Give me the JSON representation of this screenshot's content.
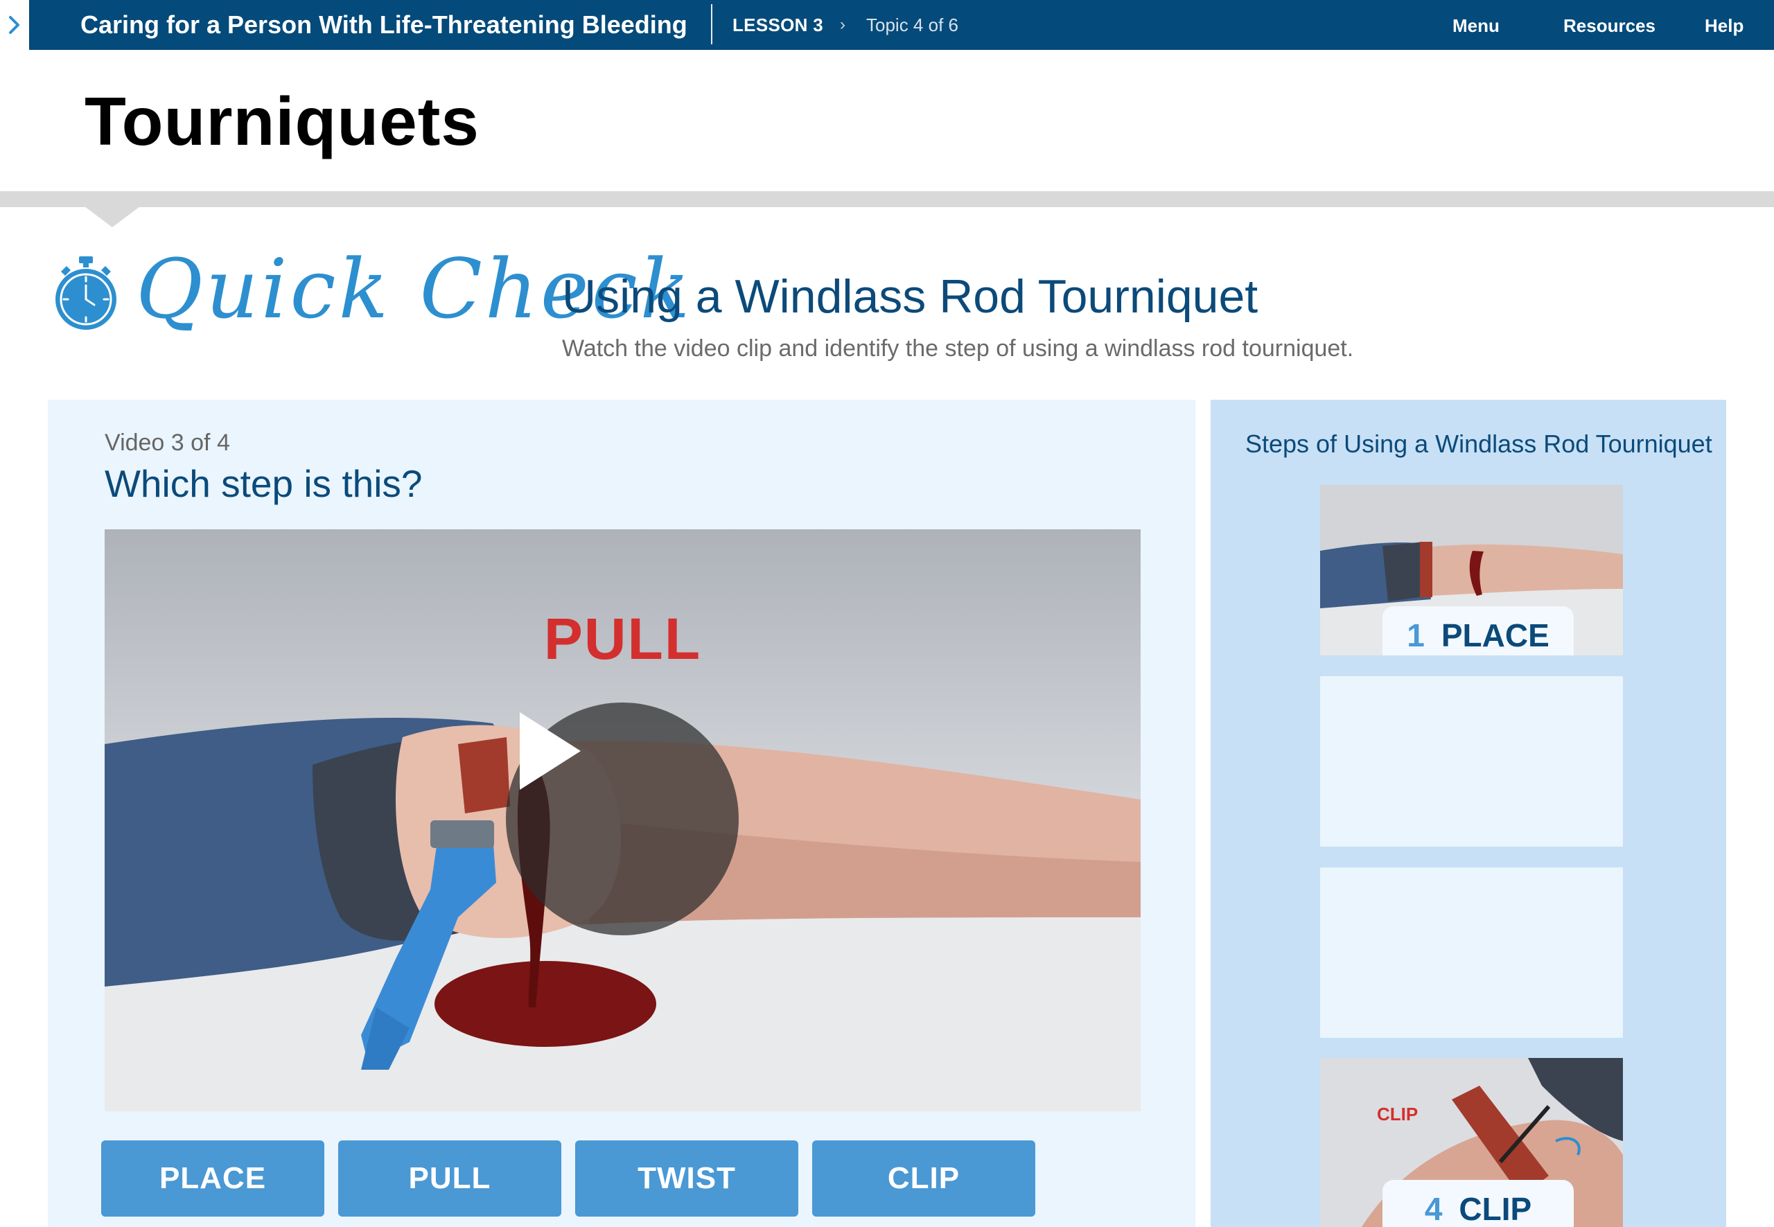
{
  "topbar": {
    "course_title": "Caring for a Person With Life-Threatening Bleeding",
    "lesson": "LESSON 3",
    "topic": "Topic 4 of 6",
    "nav": {
      "menu": "Menu",
      "resources": "Resources",
      "help": "Help"
    }
  },
  "page": {
    "title": "Tourniquets"
  },
  "activity": {
    "badge": "Quick Check",
    "title": "Using a Windlass Rod Tourniquet",
    "instructions": "Watch the video clip and identify the step of using a windlass rod tourniquet."
  },
  "video": {
    "counter": "Video 3 of 4",
    "question": "Which step is this?",
    "overlay_label": "PULL"
  },
  "answers": [
    "PLACE",
    "PULL",
    "TWIST",
    "CLIP"
  ],
  "steps_panel": {
    "heading": "Steps of Using a Windlass Rod Tourniquet",
    "steps": [
      {
        "number": "1",
        "name": "PLACE",
        "revealed": true
      },
      {
        "number": "",
        "name": "",
        "revealed": false
      },
      {
        "number": "",
        "name": "",
        "revealed": false
      },
      {
        "number": "4",
        "name": "CLIP",
        "revealed": true,
        "image_label": "CLIP"
      }
    ]
  },
  "colors": {
    "nav_bar": "#044a7a",
    "accent_blue": "#4a98d4",
    "heading_navy": "#0b4a7a",
    "panel_light": "#eaf5fd",
    "panel_steps": "#c7e0f5",
    "overlay_red": "#d32f2f"
  }
}
